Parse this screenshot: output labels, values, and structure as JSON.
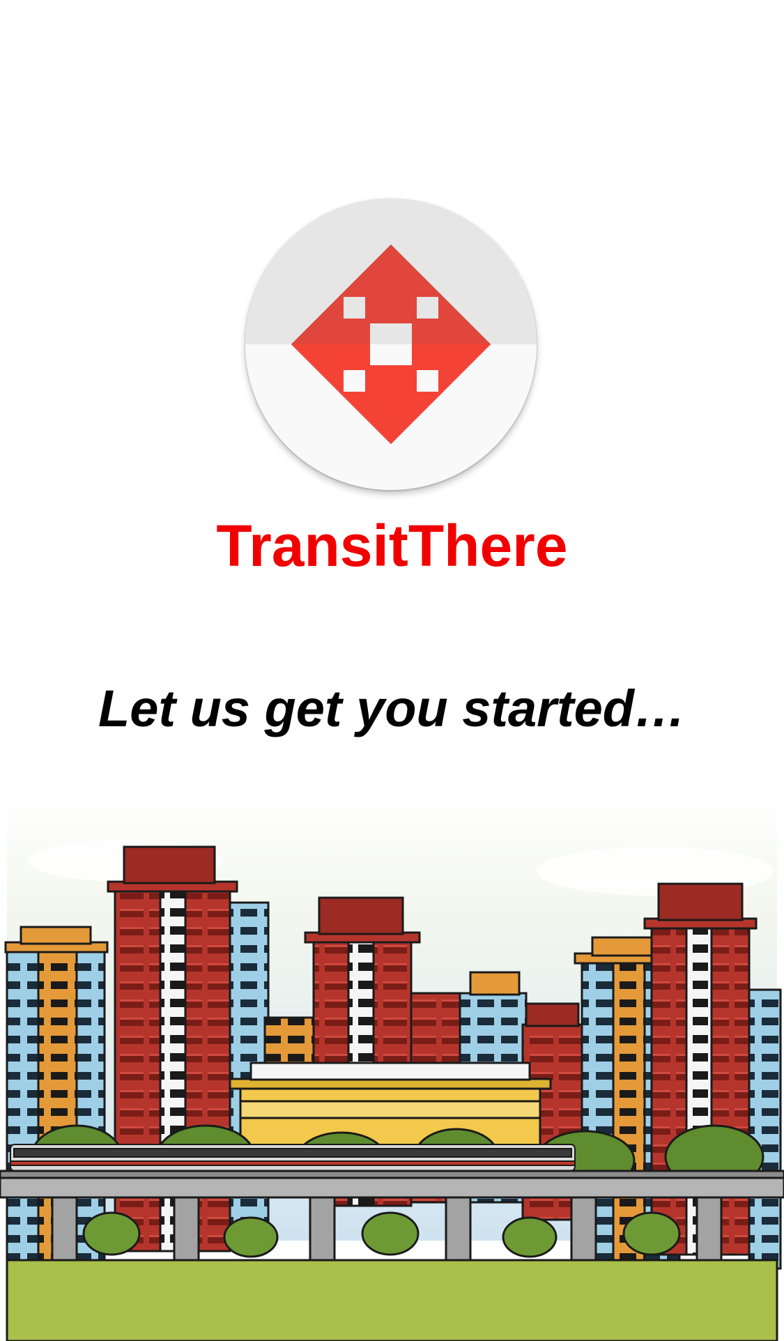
{
  "app": {
    "name": "TransitThere",
    "tagline": "Let us get you started…",
    "logo_icon": "four-way-arrows-icon",
    "brand_color": "#f10000",
    "logo_accent": "#e53935"
  },
  "illustration": {
    "name": "city-skyline-with-elevated-train",
    "ground_color": "#a9c04a",
    "sky_color": "#d7e7f1"
  }
}
